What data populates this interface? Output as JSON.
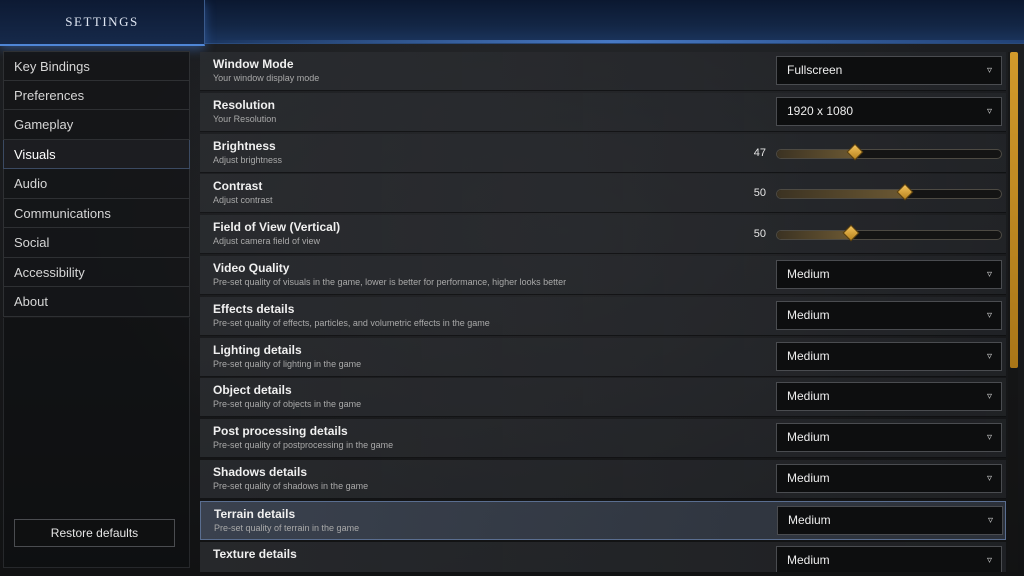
{
  "header": {
    "title": "SETTINGS"
  },
  "sidebar": {
    "items": [
      {
        "label": "Key Bindings",
        "active": false
      },
      {
        "label": "Preferences",
        "active": false
      },
      {
        "label": "Gameplay",
        "active": false
      },
      {
        "label": "Visuals",
        "active": true
      },
      {
        "label": "Audio",
        "active": false
      },
      {
        "label": "Communications",
        "active": false
      },
      {
        "label": "Social",
        "active": false
      },
      {
        "label": "Accessibility",
        "active": false
      },
      {
        "label": "About",
        "active": false
      }
    ],
    "restore_label": "Restore defaults"
  },
  "settings": [
    {
      "label": "Window Mode",
      "desc": "Your window display mode",
      "type": "dropdown",
      "value": "Fullscreen"
    },
    {
      "label": "Resolution",
      "desc": "Your Resolution",
      "type": "dropdown",
      "value": "1920 x 1080"
    },
    {
      "label": "Brightness",
      "desc": "Adjust brightness",
      "type": "slider",
      "value": "47",
      "fraction": 0.35
    },
    {
      "label": "Contrast",
      "desc": "Adjust contrast",
      "type": "slider",
      "value": "50",
      "fraction": 0.57
    },
    {
      "label": "Field of View (Vertical)",
      "desc": "Adjust camera field of view",
      "type": "slider",
      "value": "50",
      "fraction": 0.33
    },
    {
      "label": "Video Quality",
      "desc": "Pre-set quality of visuals in the game, lower is better for performance, higher looks better",
      "type": "dropdown",
      "value": "Medium"
    },
    {
      "label": "Effects details",
      "desc": "Pre-set quality of effects, particles, and volumetric effects in the game",
      "type": "dropdown",
      "value": "Medium"
    },
    {
      "label": "Lighting details",
      "desc": "Pre-set quality of lighting in the game",
      "type": "dropdown",
      "value": "Medium"
    },
    {
      "label": "Object details",
      "desc": "Pre-set quality of objects in the game",
      "type": "dropdown",
      "value": "Medium"
    },
    {
      "label": "Post processing details",
      "desc": "Pre-set quality of postprocessing in the game",
      "type": "dropdown",
      "value": "Medium"
    },
    {
      "label": "Shadows details",
      "desc": "Pre-set quality of shadows in the game",
      "type": "dropdown",
      "value": "Medium"
    },
    {
      "label": "Terrain details",
      "desc": "Pre-set quality of terrain in the game",
      "type": "dropdown",
      "value": "Medium",
      "highlight": true
    },
    {
      "label": "Texture details",
      "desc": "",
      "type": "dropdown",
      "value": "Medium"
    }
  ],
  "colors": {
    "accent": "#d29a2b",
    "header_blue": "#1b355e",
    "knob": "#f3c25a"
  },
  "icons": {
    "dropdown_chevron": "chevron-down-icon"
  }
}
